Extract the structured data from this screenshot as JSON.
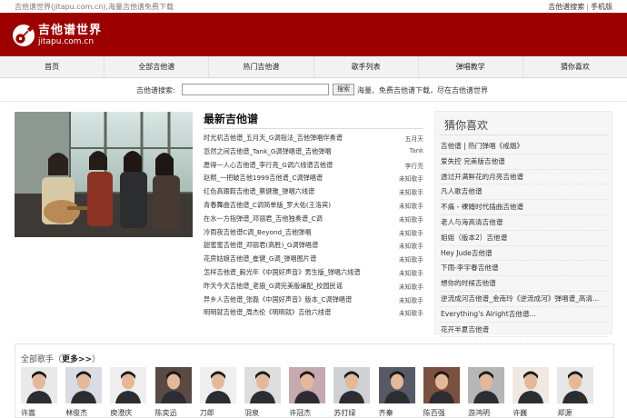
{
  "topbar": {
    "site_info": "吉他谱世界(jitapu.com.cn),海量吉他谱免费下载",
    "links": [
      "吉他谱搜索",
      "手机版"
    ]
  },
  "header": {
    "logo_name": "吉他谱世界",
    "logo_domain": "jitapu.com.cn",
    "bg_color": "#9d0000"
  },
  "nav": {
    "items": [
      "首页",
      "全部吉他谱",
      "热门吉他谱",
      "歌手列表",
      "弹唱教学",
      "猜你喜欢"
    ]
  },
  "search": {
    "label": "吉他谱搜索:",
    "value": "",
    "button": "搜索",
    "hint": "海量、免费吉他谱下载，尽在吉他谱世界"
  },
  "latest": {
    "title": "最新吉他谱",
    "rows": [
      {
        "title": "时光机吉他谱_五月天_G调指法_吉他弹唱伴奏谱",
        "artist": "五月天"
      },
      {
        "title": "忽然之间吉他谱_Tank_G调弹唱谱_吉他弹唱",
        "artist": "Tank"
      },
      {
        "title": "愿得一人心吉他谱_李行亮_G调六线谱吉他谱",
        "artist": "李行亮"
      },
      {
        "title": "赵照_一把破吉他1999吉他谱_C调弹唱谱",
        "artist": "未知歌手"
      },
      {
        "title": "红色高跟鞋吉他谱_蔡健雅_弹唱六线谱",
        "artist": "未知歌手"
      },
      {
        "title": "青春舞曲吉他谱_C调简单版_罗大佑(王洛宾)",
        "artist": "未知歌手"
      },
      {
        "title": "在水一方指弹谱_邓丽君_吉他独奏谱_C调",
        "artist": "未知歌手"
      },
      {
        "title": "冷雨夜吉他谱C调_Beyond_吉他弹唱",
        "artist": "未知歌手"
      },
      {
        "title": "甜蜜蜜吉他谱_邓丽君(高胜)_G调弹唱谱",
        "artist": "未知歌手"
      },
      {
        "title": "花房姑娘吉他谱_崔健_G调_弹唱图片谱",
        "artist": "未知歌手"
      },
      {
        "title": "怎样吉他谱_毅光年《中国好声音》男生版_弹唱六线谱",
        "artist": "未知歌手"
      },
      {
        "title": "昨天今天吉他谱_老狼_G调完美版编配_校园民谣",
        "artist": "未知歌手"
      },
      {
        "title": "异乡人吉他谱_张磊《中国好声音》版本_C调弹唱谱",
        "artist": "未知歌手"
      },
      {
        "title": "明明就吉他谱_周杰伦《明明就》吉他六线谱",
        "artist": "未知歌手"
      }
    ]
  },
  "guess": {
    "title": "猜你喜欢",
    "items": [
      "吉他谱 | 热门弹唱《戒烟》",
      "爱失控 完美版吉他谱",
      "透过开满鲜花的月亮吉他谱",
      "凡人歌吉他谱",
      "不痛 - 裸婚时代插曲吉他谱",
      "老人与海高清吉他谱",
      "姐姐（版本2）吉他谱",
      "Hey Jude吉他谱",
      "下雨-李宇春吉他谱",
      "想你的时候吉他谱",
      "逆流成河吉他谱_金南玲《逆流成河》弹唱谱_高清...",
      "Everything's Alright吉他谱...",
      "花开半夏吉他谱"
    ]
  },
  "singers": {
    "heading": "全部歌手",
    "more": "更多>>",
    "list": [
      {
        "name": "许嵩",
        "bg": "#e9e9e9"
      },
      {
        "name": "林俊杰",
        "bg": "#d9dde3"
      },
      {
        "name": "庾澄庆",
        "bg": "#eeeeee"
      },
      {
        "name": "陈奕迅",
        "bg": "#5a4a44"
      },
      {
        "name": "刀郎",
        "bg": "#efefef"
      },
      {
        "name": "羽泉",
        "bg": "#dedede"
      },
      {
        "name": "许冠杰",
        "bg": "#c7a9b0"
      },
      {
        "name": "苏打绿",
        "bg": "#cfd1d4"
      },
      {
        "name": "齐秦",
        "bg": "#555a66"
      },
      {
        "name": "陈百强",
        "bg": "#7a5140"
      },
      {
        "name": "游鸿明",
        "bg": "#b6b6b6"
      },
      {
        "name": "许巍",
        "bg": "#efe9e2"
      },
      {
        "name": "郑源",
        "bg": "#e7e7e7"
      }
    ]
  }
}
